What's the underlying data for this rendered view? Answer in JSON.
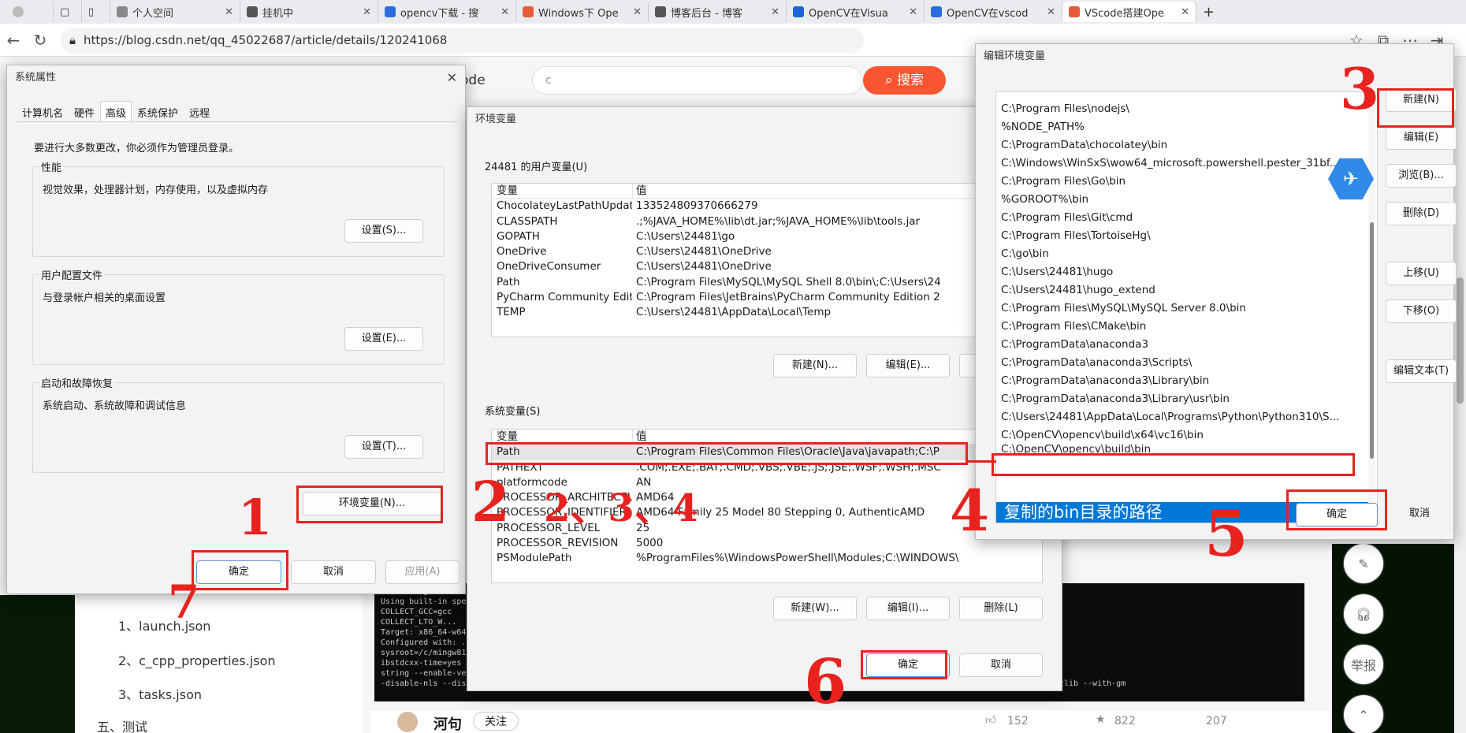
{
  "browser": {
    "tabs": [
      {
        "label": "个人空间",
        "color": "#888"
      },
      {
        "label": "挂机中",
        "color": "#c33"
      },
      {
        "label": "opencv下载 - 搜",
        "color": "#2b6de0"
      },
      {
        "label": "Windows下 Ope",
        "color": "#e85a3a"
      },
      {
        "label": "博客后台 - 博客",
        "color": "#555"
      },
      {
        "label": "OpenCV在Visua",
        "color": "#1c64d8"
      },
      {
        "label": "OpenCV在vscod",
        "color": "#2b6de0"
      },
      {
        "label": "VScode搭建Ope",
        "color": "#e85a3a"
      }
    ],
    "url": "https://blog.csdn.net/qq_45022687/article/details/120241068"
  },
  "page": {
    "search_value": "c",
    "search_label": "搜索",
    "code_fragment": "ode",
    "toc_items": [
      "1、launch.json",
      "2、c_cpp_properties.json",
      "3、tasks.json"
    ],
    "toc_section": "五、测试",
    "author": "河句",
    "follow": "关注",
    "likes": "152",
    "stars": "822",
    "comments": "207",
    "side_report": "举报",
    "terminal_text": "C:\\Users\\gorn...\nUsing built-in specs.\nCOLLECT_GCC=gcc\nCOLLECT_LTO_W...\nTarget: x86_64-w64-mingw32\nConfigured with: ../../../src/gcc-8.1.0/configure --host=x86_64-w64-mingw32 --prefix=/mingw64 --with-\nsysroot=/c/mingw810/x86_64-810-posix-seh-rt_v6-rev0/mingw64 --enable-languages=c,c++,fortran,lto --enable-l\nibstdcxx-time=yes --enable-threads=posix --enable-libgomp --enable-checking=release --enable-fully-dynamic-\nstring --enable-version-specific-runtime-libs --disable-rpath --disable-win32-registry --\n-disable-nls --disable-werror --disable-symvers --with-gnu-as --with-gnu-ld --with-arch=nocona --with-tune=core2 --with-libiconv --with-system-zlib --with-gm"
  },
  "sysprops": {
    "title": "系统属性",
    "tabs": [
      "计算机名",
      "硬件",
      "高级",
      "系统保护",
      "远程"
    ],
    "admin_note": "要进行大多数更改，你必须作为管理员登录。",
    "perf_label": "性能",
    "perf_desc": "视觉效果，处理器计划，内存使用，以及虚拟内存",
    "perf_btn": "设置(S)...",
    "profile_label": "用户配置文件",
    "profile_desc": "与登录帐户相关的桌面设置",
    "profile_btn": "设置(E)...",
    "startup_label": "启动和故障恢复",
    "startup_desc": "系统启动、系统故障和调试信息",
    "startup_btn": "设置(T)...",
    "env_btn": "环境变量(N)...",
    "ok": "确定",
    "cancel": "取消",
    "apply": "应用(A)"
  },
  "envvars": {
    "title": "环境变量",
    "user_label": "24481 的用户变量(U)",
    "col_var": "变量",
    "col_val": "值",
    "user_rows": [
      [
        "ChocolateyLastPathUpdate",
        "133524809370666279"
      ],
      [
        "CLASSPATH",
        ".;%JAVA_HOME%\\lib\\dt.jar;%JAVA_HOME%\\lib\\tools.jar"
      ],
      [
        "GOPATH",
        "C:\\Users\\24481\\go"
      ],
      [
        "OneDrive",
        "C:\\Users\\24481\\OneDrive"
      ],
      [
        "OneDriveConsumer",
        "C:\\Users\\24481\\OneDrive"
      ],
      [
        "Path",
        "C:\\Program Files\\MySQL\\MySQL Shell 8.0\\bin\\;C:\\Users\\24"
      ],
      [
        "PyCharm Community Edition",
        "C:\\Program Files\\JetBrains\\PyCharm Community Edition 2"
      ],
      [
        "TEMP",
        "C:\\Users\\24481\\AppData\\Local\\Temp"
      ]
    ],
    "user_new": "新建(N)...",
    "user_edit": "编辑(E)...",
    "sys_label": "系统变量(S)",
    "sys_rows": [
      [
        "Path",
        "C:\\Program Files\\Common Files\\Oracle\\Java\\javapath;C:\\P"
      ],
      [
        "PATHEXT",
        ".COM;.EXE;.BAT;.CMD;.VBS;.VBE;.JS;.JSE;.WSF;.WSH;.MSC"
      ],
      [
        "platformcode",
        "AN"
      ],
      [
        "PROCESSOR_ARCHITECTURE",
        "AMD64"
      ],
      [
        "PROCESSOR_IDENTIFIER",
        "AMD64 Family 25 Model 80 Stepping 0, AuthenticAMD"
      ],
      [
        "PROCESSOR_LEVEL",
        "25"
      ],
      [
        "PROCESSOR_REVISION",
        "5000"
      ],
      [
        "PSModulePath",
        "%ProgramFiles%\\WindowsPowerShell\\Modules;C:\\WINDOWS\\"
      ]
    ],
    "sys_new": "新建(W)...",
    "sys_edit": "编辑(I)...",
    "sys_delete": "删除(L)",
    "ok": "确定",
    "cancel": "取消"
  },
  "editenv": {
    "title": "编辑环境变量",
    "paths": [
      "C:\\Program Files\\nodejs\\",
      "%NODE_PATH%",
      "C:\\ProgramData\\chocolatey\\bin",
      "C:\\Windows\\WinSxS\\wow64_microsoft.powershell.pester_31bf...",
      "C:\\Program Files\\Go\\bin",
      "%GOROOT%\\bin",
      "C:\\Program Files\\Git\\cmd",
      "C:\\Program Files\\TortoiseHg\\",
      "C:\\go\\bin",
      "C:\\Users\\24481\\hugo",
      "C:\\Users\\24481\\hugo_extend",
      "C:\\Program Files\\MySQL\\MySQL Server 8.0\\bin",
      "C:\\Program Files\\CMake\\bin",
      "C:\\ProgramData\\anaconda3",
      "C:\\ProgramData\\anaconda3\\Scripts\\",
      "C:\\ProgramData\\anaconda3\\Library\\bin",
      "C:\\ProgramData\\anaconda3\\Library\\usr\\bin",
      "C:\\Users\\24481\\AppData\\Local\\Programs\\Python\\Python310\\S...",
      "C:\\OpenCV\\opencv\\build\\x64\\vc16\\bin",
      "C:\\OpenCV\\opencv\\build\\bin"
    ],
    "new_entry": "复制的bin目录的路径",
    "btn_new": "新建(N)",
    "btn_edit": "编辑(E)",
    "btn_browse": "浏览(B)...",
    "btn_delete": "删除(D)",
    "btn_up": "上移(U)",
    "btn_down": "下移(O)",
    "btn_edittext": "编辑文本(T)",
    "ok": "确定",
    "cancel": "取消"
  },
  "annotations": {
    "n1": "1",
    "n2": "2",
    "n3": "3",
    "n4": "4",
    "n5": "5",
    "n6": "6",
    "n7": "7",
    "n_extra": "2、3、4"
  },
  "colors": {
    "annotation": "#e8231f",
    "selection": "#0078d7",
    "csdn_red": "#fc5531"
  }
}
